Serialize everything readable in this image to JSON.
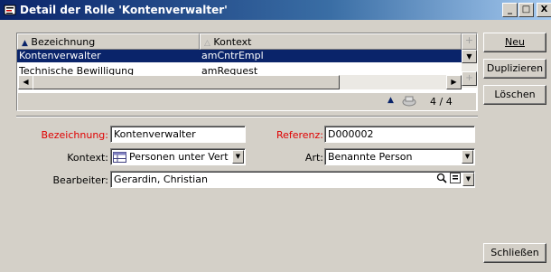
{
  "window": {
    "title": "Detail der Rolle 'Kontenverwalter'",
    "minimize_label": "_",
    "maximize_label": "□",
    "close_label": "X"
  },
  "list": {
    "columns": [
      {
        "label": "Bezeichnung",
        "sort": "ascending"
      },
      {
        "label": "Kontext",
        "sort": "none"
      }
    ],
    "rows": [
      {
        "bezeichnung": "Kontenverwalter",
        "kontext": "amCntrEmpl",
        "selected": true
      },
      {
        "bezeichnung": "Technische Bewilligung",
        "kontext": "amRequest",
        "selected": false
      }
    ],
    "counter": "4 / 4"
  },
  "buttons": {
    "neu": "Neu",
    "duplizieren": "Duplizieren",
    "loeschen": "Löschen",
    "schliessen": "Schließen"
  },
  "form": {
    "bezeichnung_label": "Bezeichnung:",
    "bezeichnung_value": "Kontenverwalter",
    "referenz_label": "Referenz:",
    "referenz_value": "D000002",
    "kontext_label": "Kontext:",
    "kontext_value": "Personen unter Vert",
    "art_label": "Art:",
    "art_value": "Benannte Person",
    "bearbeiter_label": "Bearbeiter:",
    "bearbeiter_value": "Gerardin, Christian"
  },
  "colors": {
    "titlebar": "#0a246a",
    "selection": "#0a246a",
    "mandatory_label": "#e00000",
    "face": "#d4d0c8"
  }
}
